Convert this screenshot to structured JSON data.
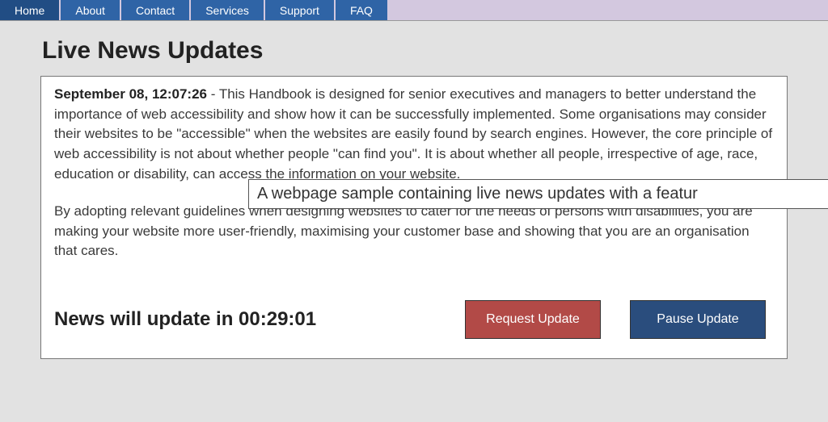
{
  "nav": {
    "items": [
      {
        "label": "Home",
        "active": true
      },
      {
        "label": "About",
        "active": false
      },
      {
        "label": "Contact",
        "active": false
      },
      {
        "label": "Services",
        "active": false
      },
      {
        "label": "Support",
        "active": false
      },
      {
        "label": "FAQ",
        "active": false
      }
    ]
  },
  "title": "Live News Updates",
  "news": {
    "timestamp": "September 08, 12:07:26",
    "para1": "This Handbook is designed for senior executives and managers to better understand the importance of web accessibility and show how it can be successfully implemented. Some organisations may consider their websites to be \"accessible\" when the websites are easily found by search engines. However, the core principle of web accessibility is not about whether people \"can find you\". It is about whether all people, irrespective of age, race, education or disability, can access the information on your website.",
    "para2": "By adopting relevant guidelines when designing websites to cater for the needs of persons with disabilities, you are making your website more user-friendly, maximising your customer base and showing that you are an organisation that cares."
  },
  "countdown": {
    "prefix": "News will update in ",
    "time": "00:29:01"
  },
  "buttons": {
    "request": "Request Update",
    "pause": "Pause Update"
  },
  "tooltip": "A webpage sample containing live news updates with a featur"
}
